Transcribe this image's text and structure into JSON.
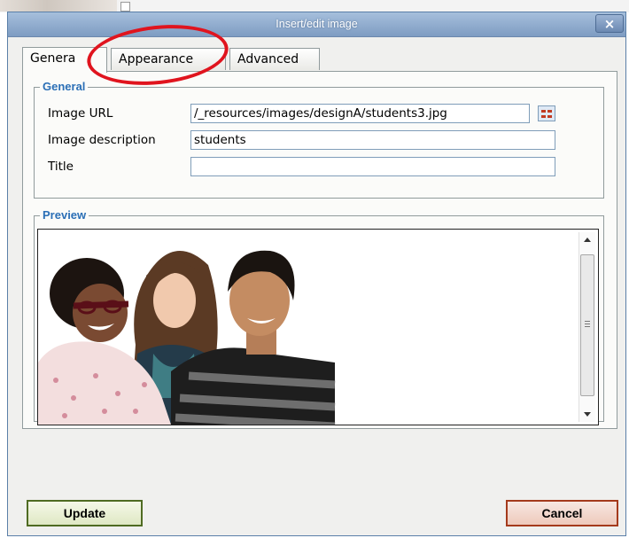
{
  "window": {
    "title": "Insert/edit image",
    "close_label": "×"
  },
  "tabs": [
    {
      "label": "Genera",
      "active": true
    },
    {
      "label": "Appearance",
      "active": false
    },
    {
      "label": "Advanced",
      "active": false
    }
  ],
  "general": {
    "legend": "General",
    "image_url": {
      "label": "Image URL",
      "value": "/_resources/images/designA/students3.jpg"
    },
    "description": {
      "label": "Image description",
      "value": "students"
    },
    "title": {
      "label": "Title",
      "value": ""
    }
  },
  "preview": {
    "legend": "Preview"
  },
  "buttons": {
    "update": "Update",
    "cancel": "Cancel"
  },
  "colors": {
    "legend": "#2b6fb6",
    "titlebar": "#8aa6cb",
    "annotation": "#e0141e"
  }
}
